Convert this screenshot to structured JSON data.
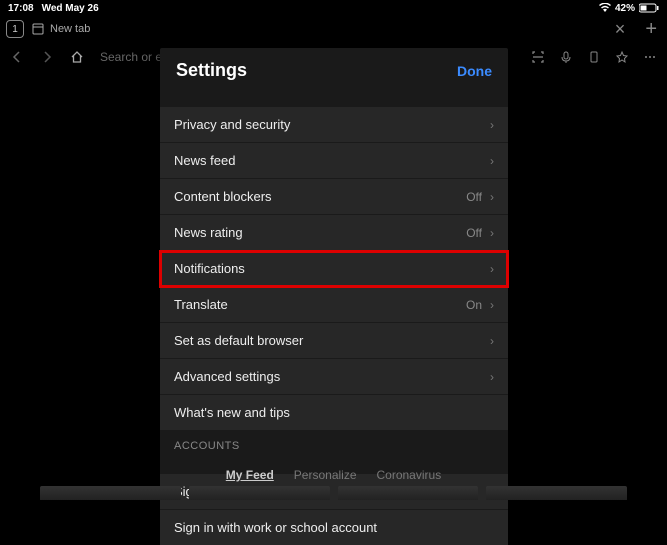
{
  "status": {
    "time": "17:08",
    "date": "Wed May 26",
    "battery": "42%"
  },
  "tabs": {
    "count": "1",
    "current": "New tab"
  },
  "toolbar": {
    "search_placeholder": "Search or enter URL"
  },
  "modal": {
    "title": "Settings",
    "done": "Done",
    "rows": [
      {
        "label": "Privacy and security",
        "value": ""
      },
      {
        "label": "News feed",
        "value": ""
      },
      {
        "label": "Content blockers",
        "value": "Off"
      },
      {
        "label": "News rating",
        "value": "Off"
      },
      {
        "label": "Notifications",
        "value": ""
      },
      {
        "label": "Translate",
        "value": "On"
      },
      {
        "label": "Set as default browser",
        "value": ""
      },
      {
        "label": "Advanced settings",
        "value": ""
      },
      {
        "label": "What's new and tips",
        "value": ""
      }
    ],
    "accounts_header": "ACCOUNTS",
    "accounts": [
      {
        "label": "Sign in"
      },
      {
        "label": "Sign in with work or school account"
      }
    ]
  },
  "feed_tabs": {
    "items": [
      "My Feed",
      "Personalize",
      "Coronavirus"
    ]
  }
}
